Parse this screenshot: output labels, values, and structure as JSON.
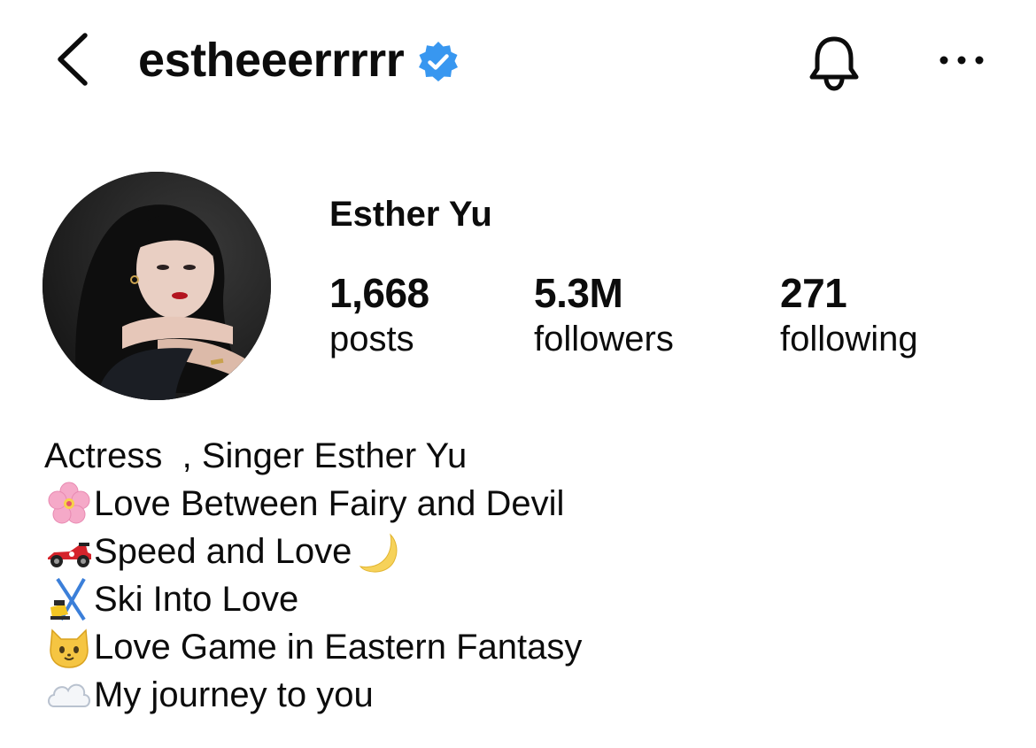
{
  "header": {
    "username": "estheeerrrrr",
    "verified": true,
    "icons": [
      "back-chevron-icon",
      "verified-badge-icon",
      "bell-icon",
      "more-dots-icon"
    ]
  },
  "profile": {
    "display_name": "Esther Yu",
    "avatar_icon": "profile-photo",
    "stats": {
      "posts": {
        "value": "1,668",
        "label": "posts"
      },
      "followers": {
        "value": "5.3M",
        "label": "followers"
      },
      "following": {
        "value": "271",
        "label": "following"
      }
    }
  },
  "bio": {
    "line1": "Actress  , Singer Esther Yu",
    "line2": {
      "emoji": "cherry-blossom-icon",
      "text": "Love Between Fairy and Devil"
    },
    "line3": {
      "emoji": "racing-car-icon",
      "text": "Speed and Love",
      "trailing_emoji": "crescent-moon-icon"
    },
    "line4": {
      "emoji": "skier-icon",
      "text": "Ski Into Love"
    },
    "line5": {
      "emoji": "cat-face-icon",
      "text": "Love Game in Eastern Fantasy"
    },
    "line6": {
      "emoji": "cloud-icon",
      "text": "My journey to you"
    }
  },
  "colors": {
    "verified_blue": "#3897f0",
    "text": "#0c0c0c",
    "background": "#ffffff"
  }
}
